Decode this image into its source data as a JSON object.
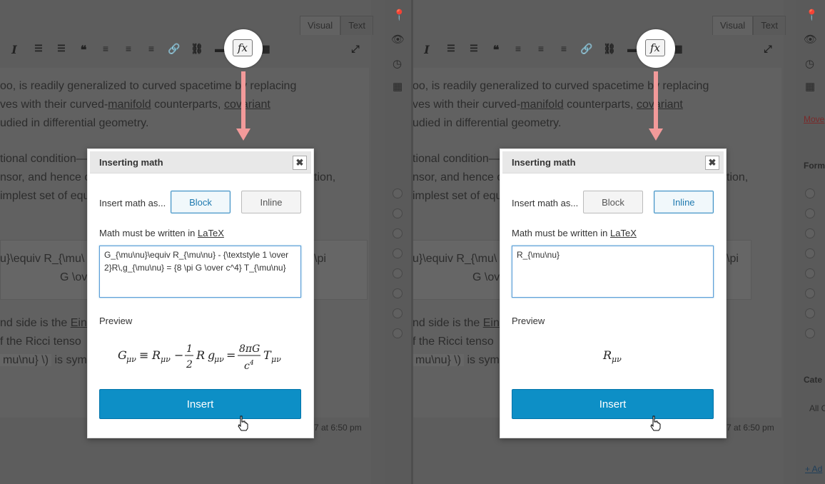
{
  "tabs": {
    "visual": "Visual",
    "text": "Text"
  },
  "toolbar": {
    "italic": "I",
    "quote": "❝",
    "fx": "fx",
    "icons": [
      "italic-icon",
      "bullet-list-icon",
      "numbered-list-icon",
      "blockquote-icon",
      "align-left-icon",
      "align-center-icon",
      "align-right-icon",
      "link-icon",
      "unlink-icon",
      "read-more-icon",
      "insert-math-icon",
      "table-icon",
      "fullscreen-icon"
    ]
  },
  "background": {
    "line1": "oo, is readily generalized to curved spacetime by replacing",
    "line2_a": "ves with their curved-",
    "line2_link": "manifold",
    "line2_b": " counterparts, ",
    "line2_link2": "covariant",
    "line3": "udied in differential geometry.",
    "line4": "tional condition—",
    "line5": "nsor, and hence c",
    "line5_end": "tion,",
    "line6": "implest set of equ",
    "formula_a": "u}\\equiv R_{\\mu\\",
    "formula_b": "\\pi",
    "formula_c": "G \\ov",
    "line7_a": "nd side is the ",
    "line7_link": "Ein",
    "line8": "f the Ricci tenso",
    "line9_a": "mu\\nu} \\)",
    "line9_b": " is sym",
    "timestamp": "7 at 6:50 pm",
    "sidebar_move": "Move",
    "sidebar_format": "Form",
    "sidebar_cate": "Cate",
    "sidebar_all": "All C",
    "sidebar_add": "+ Ad"
  },
  "dialogs": [
    {
      "title": "Inserting math",
      "close": "✖",
      "insert_as": "Insert math as...",
      "block": "Block",
      "inline": "Inline",
      "selected": "block",
      "must_prefix": "Math must be written in ",
      "latex_link": "LaTeX",
      "latex_value": "G_{\\mu\\nu}\\equiv R_{\\mu\\nu} - {\\textstyle 1 \\over 2}R\\,g_{\\mu\\nu} = {8 \\pi G \\over c^4} T_{\\mu\\nu}",
      "preview_label": "Preview",
      "insert": "Insert"
    },
    {
      "title": "Inserting math",
      "close": "✖",
      "insert_as": "Insert math as...",
      "block": "Block",
      "inline": "Inline",
      "selected": "inline",
      "must_prefix": "Math must be written in ",
      "latex_link": "LaTeX",
      "latex_value": "R_{\\mu\\nu}",
      "preview_label": "Preview",
      "insert": "Insert"
    }
  ],
  "colors": {
    "accent": "#0d8fc6",
    "arrow": "#f29a9a",
    "overlay": "#5b5b5b"
  }
}
